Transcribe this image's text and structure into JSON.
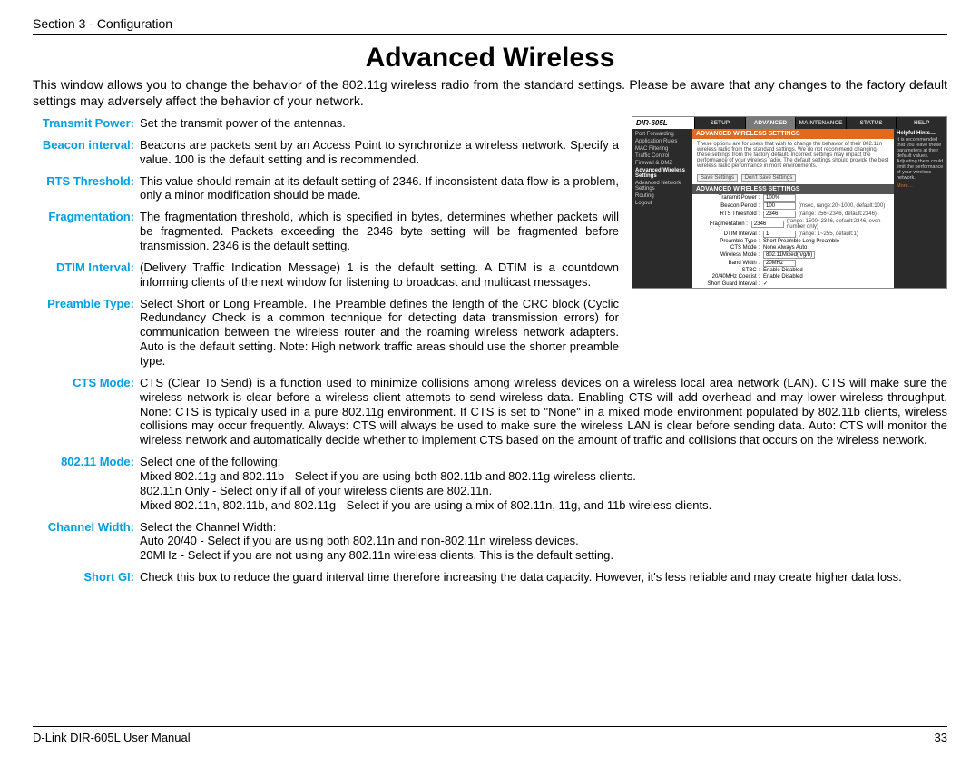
{
  "header": {
    "section": "Section 3 - Configuration"
  },
  "title": "Advanced Wireless",
  "intro": "This window allows you to change the behavior of the 802.11g wireless radio from the standard settings. Please be aware that any changes to the factory default settings may adversely affect the behavior of your network.",
  "defs": {
    "transmit_power": {
      "label": "Transmit Power:",
      "text": "Set the transmit power of the antennas."
    },
    "beacon_interval": {
      "label": "Beacon interval:",
      "text": "Beacons are packets sent by an Access Point to synchronize a wireless network. Specify a value. 100 is the default setting and is recommended."
    },
    "rts_threshold": {
      "label": "RTS Threshold:",
      "text": "This value should remain at its default setting of 2346. If inconsistent data flow is a problem, only a minor modification should be made."
    },
    "fragmentation": {
      "label": "Fragmentation:",
      "text": "The fragmentation threshold, which is specified in bytes, determines whether packets will be fragmented. Packets exceeding the 2346 byte setting will be fragmented before transmission. 2346 is the default setting."
    },
    "dtim_interval": {
      "label": "DTIM Interval:",
      "text": "(Delivery Traffic Indication Message) 1 is the default setting. A DTIM is a countdown informing clients of the next window for listening to broadcast and multicast messages."
    },
    "preamble_type": {
      "label": "Preamble Type:",
      "text": "Select Short or Long Preamble. The Preamble defines the length of the CRC block (Cyclic Redundancy Check is a common technique for detecting data transmission errors) for communication between the wireless router and the roaming wireless network adapters. Auto is the default setting. Note: High network traffic areas should use the shorter preamble type."
    },
    "cts_mode": {
      "label": "CTS Mode:",
      "text": "CTS (Clear To Send) is a function used to minimize collisions among wireless devices on a wireless local area network (LAN). CTS will make sure the wireless network is clear before a wireless client attempts to send wireless data. Enabling CTS will add overhead and may lower wireless throughput. None: CTS is typically used in a pure 802.11g environment. If CTS is set to \"None\" in a mixed mode environment populated by 802.11b clients, wireless collisions may occur frequently. Always: CTS will always be used to make sure the wireless LAN is clear before sending data. Auto: CTS will monitor the wireless network and automatically decide whether to implement CTS based on the amount of traffic and collisions that occurs on the wireless network."
    },
    "mode_80211": {
      "label": "802.11 Mode:",
      "text": "Select one of the following:\nMixed 802.11g and 802.11b - Select if you are using both 802.11b and 802.11g wireless clients.\n802.11n Only - Select only if all of your wireless clients are 802.11n.\nMixed 802.11n, 802.11b, and 802.11g - Select if you are using a mix of 802.11n, 11g, and 11b wireless clients."
    },
    "channel_width": {
      "label": "Channel Width:",
      "text": "Select the Channel Width:\nAuto 20/40 - Select if you are using both 802.11n and non-802.11n wireless devices.\n20MHz - Select if you are not using any 802.11n wireless clients. This is the default setting."
    },
    "short_gi": {
      "label": "Short GI:",
      "text": "Check this box to reduce the guard interval time therefore increasing the data capacity.  However, it's less reliable and may create higher data loss."
    }
  },
  "footer": {
    "manual": "D-Link DIR-605L User Manual",
    "page": "33"
  },
  "screenshot": {
    "logo": "DIR-605L",
    "tabs": [
      "SETUP",
      "ADVANCED",
      "MAINTENANCE",
      "STATUS",
      "HELP"
    ],
    "active_tab": "ADVANCED",
    "side": [
      "Port Forwarding",
      "Application Rules",
      "MAC Filtering",
      "Traffic Control",
      "Firewall & DMZ",
      "Advanced Wireless Settings",
      "Advanced Network Settings",
      "Routing",
      "Logout"
    ],
    "side_selected": "Advanced Wireless Settings",
    "title1": "ADVANCED WIRELESS SETTINGS",
    "desc": "These options are for users that wish to change the behavior of their 802.11n wireless radio from the standard settings. We do not recommend changing these settings from the factory default. Incorrect settings may impact the performance of your wireless radio. The default settings should provide the best wireless radio performance in most environments.",
    "btn_save": "Save Settings",
    "btn_dont": "Don't Save Settings",
    "title2": "ADVANCED WIRELESS SETTINGS",
    "rows": {
      "tx_power": {
        "lab": "Transmit Power :",
        "val": "100%"
      },
      "beacon": {
        "lab": "Beacon Period :",
        "val": "100",
        "hint": "(msec, range:20~1000, default:100)"
      },
      "rts": {
        "lab": "RTS Threshold :",
        "val": "2346",
        "hint": "(range: 256~2346, default:2346)"
      },
      "frag": {
        "lab": "Fragmentation :",
        "val": "2346",
        "hint": "(range: 1500~2346, default:2346, even number only)"
      },
      "dtim": {
        "lab": "DTIM Interval :",
        "val": "1",
        "hint": "(range: 1~255, default:1)"
      },
      "preamble": {
        "lab": "Preamble Type :",
        "val": "Short Preamble   Long Preamble"
      },
      "cts": {
        "lab": "CTS Mode :",
        "val": "None   Always   Auto"
      },
      "wmode": {
        "lab": "Wireless Mode :",
        "val": "802.11Mixed(n/g/b)"
      },
      "bw": {
        "lab": "Band Width :",
        "val": "20MHz"
      },
      "stbc": {
        "lab": "STBC :",
        "val": "Enable   Disabled"
      },
      "coexist": {
        "lab": "20/40MHz Coexist :",
        "val": "Enable   Disabled"
      },
      "sgi": {
        "lab": "Short Guard Interval :",
        "val": "✓"
      }
    },
    "hints_title": "Helpful Hints…",
    "hints_body": "It is recommended that you leave these parameters at their default values. Adjusting them could limit the performance of your wireless network.",
    "hints_more": "More…"
  }
}
